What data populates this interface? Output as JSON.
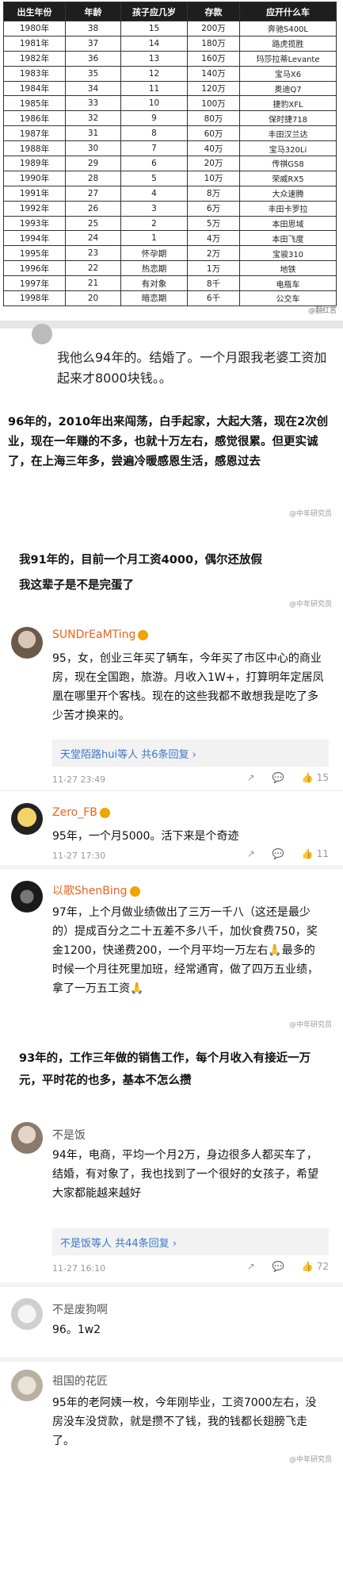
{
  "table": {
    "headers": [
      "出生年份",
      "年龄",
      "孩子应几岁",
      "存款",
      "应开什么车"
    ],
    "rows": [
      [
        "1980年",
        "38",
        "15",
        "200万",
        "奔驰S400L"
      ],
      [
        "1981年",
        "37",
        "14",
        "180万",
        "路虎揽胜"
      ],
      [
        "1982年",
        "36",
        "13",
        "160万",
        "玛莎拉蒂Levante"
      ],
      [
        "1983年",
        "35",
        "12",
        "140万",
        "宝马X6"
      ],
      [
        "1984年",
        "34",
        "11",
        "120万",
        "奥迪Q7"
      ],
      [
        "1985年",
        "33",
        "10",
        "100万",
        "捷豹XFL"
      ],
      [
        "1986年",
        "32",
        "9",
        "80万",
        "保时捷718"
      ],
      [
        "1987年",
        "31",
        "8",
        "60万",
        "丰田汉兰达"
      ],
      [
        "1988年",
        "30",
        "7",
        "40万",
        "宝马320Li"
      ],
      [
        "1989年",
        "29",
        "6",
        "20万",
        "传祺GS8"
      ],
      [
        "1990年",
        "28",
        "5",
        "10万",
        "荣威RX5"
      ],
      [
        "1991年",
        "27",
        "4",
        "8万",
        "大众速腾"
      ],
      [
        "1992年",
        "26",
        "3",
        "6万",
        "丰田卡罗拉"
      ],
      [
        "1993年",
        "25",
        "2",
        "5万",
        "本田思域"
      ],
      [
        "1994年",
        "24",
        "1",
        "4万",
        "本田飞度"
      ],
      [
        "1995年",
        "23",
        "怀孕期",
        "2万",
        "宝骏310"
      ],
      [
        "1996年",
        "22",
        "热恋期",
        "1万",
        "地铁"
      ],
      [
        "1997年",
        "21",
        "有对象",
        "8千",
        "电瓶车"
      ],
      [
        "1998年",
        "20",
        "暗恋期",
        "6千",
        "公交车"
      ]
    ],
    "credit": "@翻红苦"
  },
  "screens": {
    "s1": {
      "text": "我他么94年的。结婚了。一个月跟我老婆工资加起来才8000块钱。。"
    },
    "s2": {
      "text": "96年的，2010年出来闯荡，白手起家，大起大落，现在2次创业，现在一年赚的不多，也就十万左右，感觉很累。但更实诚了，在上海三年多，尝遍冷暖感恩生活，感恩过去",
      "wm": "@中年研究员"
    },
    "s3": {
      "text1": "我91年的，目前一个月工资4000，偶尔还放假",
      "text2": "我这辈子是不是完蛋了",
      "wm": "@中年研究员"
    },
    "s4": {
      "text": "93年的，工作三年做的销售工作，每个月收入有接近一万元，平时花的也多，基本不怎么攒"
    }
  },
  "comments": {
    "c1": {
      "name": "SUNDrEaMTing",
      "body": "95，女，创业三年买了辆车，今年买了市区中心的商业房，现在全国跑，旅游。月收入1W+，打算明年定居凤凰在哪里开个客栈。现在的这些我都不敢想我是吃了多少苦才换来的。",
      "reply": "天堂陌路hui等人  共6条回复 ›",
      "time": "11-27 23:49",
      "likes": "15"
    },
    "c2": {
      "name": "Zero_FB",
      "body": "95年，一个月5000。活下来是个奇迹",
      "time": "11-27 17:30",
      "likes": "11"
    },
    "c3": {
      "name": "以歌ShenBing",
      "body": "97年，上个月做业绩做出了三万一千八（这还是最少的）提成百分之二十五差不多八千，加伙食费750，奖金1200，快递费200，一个月平均一万左右🙏最多的时候一个月往死里加班，经常通宵，做了四万五业绩，拿了一万五工资🙏",
      "wm": "@中年研究员"
    },
    "c4": {
      "name": "不是饭",
      "body": "94年，电商，平均一个月2万，身边很多人都买车了，结婚，有对象了，我也找到了一个很好的女孩子，希望大家都能越来越好",
      "reply": "不是饭等人  共44条回复 ›",
      "time": "11-27 16:10",
      "likes": "72"
    },
    "c5": {
      "name": "不是废狗啊",
      "body": "96。1w2"
    },
    "c6": {
      "name": "祖国的花匠",
      "body": "95年的老阿姨一枚，今年刚毕业，工资7000左右，没房没车没贷款，就是攒不了钱，我的钱都长翅膀飞走了。",
      "wm": "@中年研究员"
    }
  }
}
